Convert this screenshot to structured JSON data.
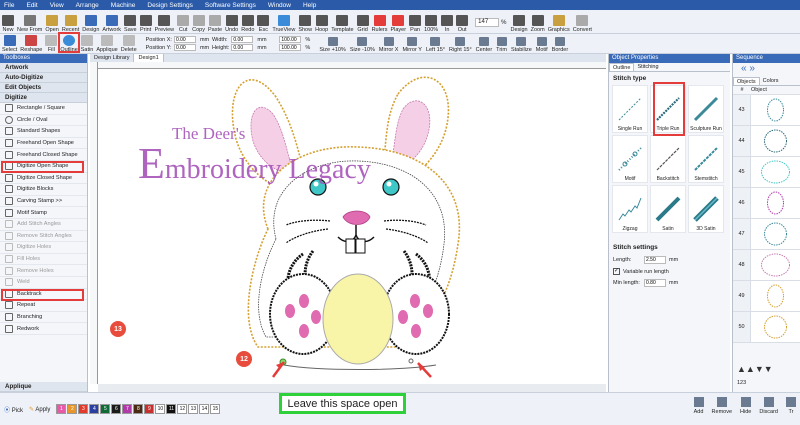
{
  "menu": [
    "File",
    "Edit",
    "View",
    "Arrange",
    "Machine",
    "Design Settings",
    "Software Settings",
    "Window",
    "Help"
  ],
  "toolbar1": [
    "New",
    "New From",
    "Open",
    "Recent",
    "Design",
    "Artwork",
    "Save",
    "Print",
    "Preview",
    "Cut",
    "Copy",
    "Paste",
    "Undo",
    "Redo",
    "Esc",
    "TrueView",
    "Show",
    "Hoop",
    "Template",
    "Grid",
    "Rulers",
    "Player",
    "Pan",
    "100%",
    "In",
    "Out",
    "Design",
    "Zoom",
    "Graphics",
    "Convert"
  ],
  "zoom_value": "147",
  "zoom_unit": "%",
  "toolbar2": {
    "tools": [
      "Select",
      "Reshape",
      "Fill",
      "Outline",
      "Satin",
      "Applique",
      "Delete"
    ],
    "position_x_label": "Position X:",
    "position_x": "0.00",
    "position_y_label": "Position Y:",
    "position_y": "0.00",
    "width_label": "Width:",
    "width": "0.00",
    "height_label": "Height:",
    "height": "0.00",
    "unit": "mm",
    "percent1": "100.00",
    "percent2": "100.00",
    "percent_unit": "%",
    "actions": [
      "Size +10%",
      "Size -10%",
      "Mirror X",
      "Mirror Y",
      "Left 15°",
      "Right 15°",
      "Center",
      "Trim",
      "Stabilize",
      "Motif",
      "Border"
    ]
  },
  "left_panel": {
    "title": "Toolboxes",
    "sections": [
      "Artwork",
      "Auto-Digitize",
      "Edit Objects",
      "Digitize"
    ],
    "items": [
      "Rectangle / Square",
      "Circle / Oval",
      "Standard Shapes",
      "Freehand Open Shape",
      "Freehand Closed Shape",
      "Digitize Open Shape",
      "Digitize Closed Shape",
      "Digitize Blocks",
      "Carving Stamp >>",
      "Motif Stamp",
      "Add Stitch Angles",
      "Remove Stitch Angles",
      "Digitize Holes",
      "Fill Holes",
      "Remove Holes",
      "Weld",
      "Backtrack",
      "Repeat",
      "Branching",
      "Redwork"
    ],
    "bottom_section": "Applique"
  },
  "doc_tabs": [
    "Design Library",
    "Design1"
  ],
  "logo": {
    "line1": "The Deer's",
    "line2_initial": "E",
    "line2_rest": "mbroidery Legacy"
  },
  "annotations": {
    "label_13": "13",
    "label_12": "12",
    "callout": "Leave this space open"
  },
  "object_properties": {
    "title": "Object Properties",
    "tabs": [
      "Outline",
      "Stitching"
    ],
    "stitch_type_heading": "Stitch type",
    "stitch_types": [
      "Single Run",
      "Triple Run",
      "Sculpture Run",
      "Motif",
      "Backstitch",
      "Stemstitch",
      "Zigzag",
      "Satin",
      "3D Satin"
    ],
    "selected_stitch": "Triple Run",
    "settings_heading": "Stitch settings",
    "length_label": "Length:",
    "length_value": "2.50",
    "length_unit": "mm",
    "variable_label": "Variable run length",
    "min_length_label": "Min length:",
    "min_length_value": "0.80",
    "min_length_unit": "mm"
  },
  "sequence": {
    "title": "Sequence",
    "tabs": [
      "Objects",
      "Colors"
    ],
    "column_number": "#",
    "column_object": "Object",
    "rows": [
      "43",
      "44",
      "45",
      "46",
      "47",
      "48",
      "49",
      "50"
    ],
    "footer_num": "123"
  },
  "status": {
    "pick_label": "Pick",
    "apply_label": "Apply",
    "swatches": [
      {
        "n": "1",
        "c": "#e75aa8"
      },
      {
        "n": "2",
        "c": "#e8962a"
      },
      {
        "n": "3",
        "c": "#e33b2b"
      },
      {
        "n": "4",
        "c": "#2a3fa0"
      },
      {
        "n": "5",
        "c": "#0e6b38"
      },
      {
        "n": "6",
        "c": "#1b1b1b"
      },
      {
        "n": "7",
        "c": "#b03aa8"
      },
      {
        "n": "8",
        "c": "#4a2a14"
      },
      {
        "n": "9",
        "c": "#c83030"
      },
      {
        "n": "10",
        "c": "#ffffff"
      },
      {
        "n": "11",
        "c": "#111111"
      },
      {
        "n": "12",
        "c": "#ffffff"
      },
      {
        "n": "13",
        "c": "#ffffff"
      },
      {
        "n": "14",
        "c": "#ffffff"
      },
      {
        "n": "15",
        "c": "#ffffff"
      }
    ],
    "buttons": [
      "Add",
      "Remove",
      "Hide",
      "Discard",
      "Tr"
    ]
  },
  "colors": {
    "accent_red": "#e43b3b",
    "callout_green": "#2fd13a",
    "logo_purple": "#a24bb5"
  }
}
